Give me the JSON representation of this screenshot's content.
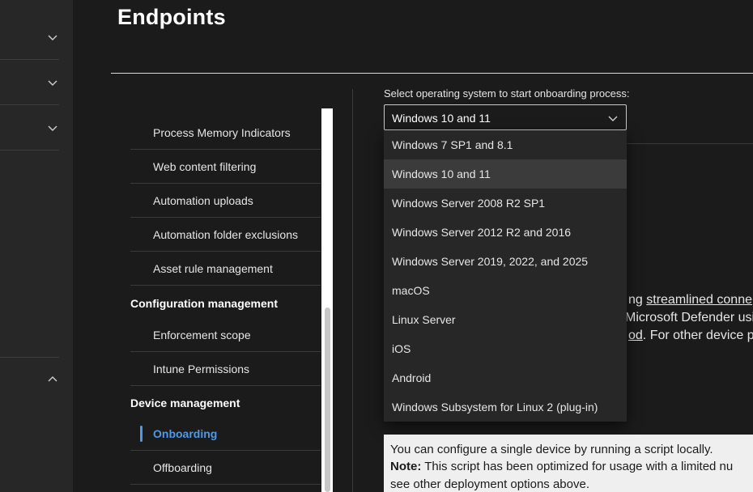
{
  "page": {
    "title": "Endpoints"
  },
  "left_nav": {
    "expand_icon": "chevron-down-icon",
    "collapse_icon": "chevron-up-icon"
  },
  "settings_nav": {
    "items": [
      {
        "label": "Process Memory Indicators"
      },
      {
        "label": "Web content filtering"
      },
      {
        "label": "Automation uploads"
      },
      {
        "label": "Automation folder exclusions"
      },
      {
        "label": "Asset rule management"
      }
    ],
    "config_section": "Configuration management",
    "config_items": [
      {
        "label": "Enforcement scope"
      },
      {
        "label": "Intune Permissions"
      }
    ],
    "device_section": "Device management",
    "device_items": [
      {
        "label": "Onboarding",
        "active": true
      },
      {
        "label": "Offboarding"
      }
    ],
    "accent_color": "#4f9ae8"
  },
  "onboarding": {
    "os_label": "Select operating system to start onboarding process:",
    "os_selected": "Windows 10 and 11",
    "os_options": [
      "Windows 7 SP1 and 8.1",
      "Windows 10 and 11",
      "Windows Server 2008 R2 SP1",
      "Windows Server 2012 R2 and 2016",
      "Windows Server 2019, 2022, and 2025",
      "macOS",
      "Linux Server",
      "iOS",
      "Android",
      "Windows Subsystem for Linux 2 (plug-in)"
    ],
    "desc_line1_pre": "ng ",
    "desc_line1_link": "streamlined conne",
    "desc_line2": "Microsoft Defender usi",
    "desc_line3_link": "od",
    "desc_line3_post": ". For other device pro",
    "info_line1": "You can configure a single device by running a script locally.",
    "info_note_label": "Note:",
    "info_line2": " This script has been optimized for usage with a limited nu",
    "info_line3": "see other deployment options above."
  }
}
